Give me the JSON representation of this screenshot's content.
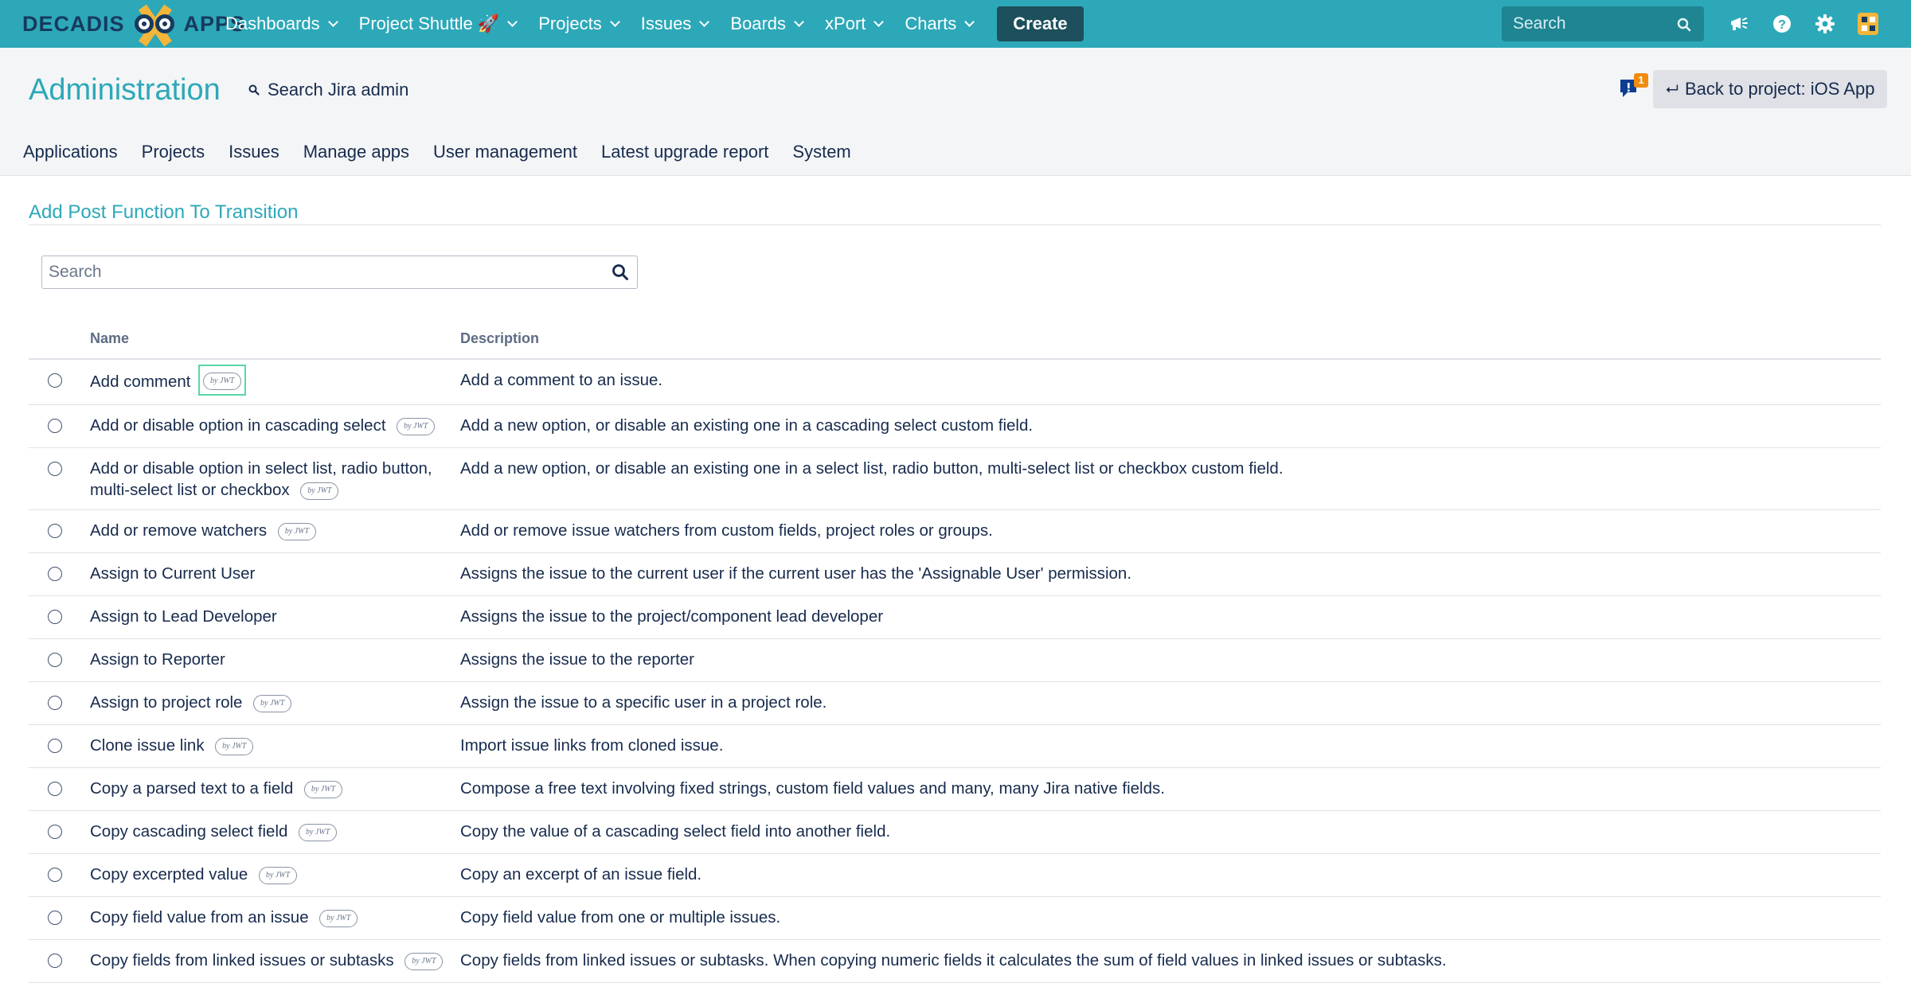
{
  "brand": {
    "name_left": "DECADIS",
    "name_right": "APPS",
    "accent": "#2da8b8",
    "dark": "#173a5e",
    "gold": "#f4b63a"
  },
  "topnav": {
    "items": [
      {
        "label": "Dashboards"
      },
      {
        "label": "Project Shuttle 🚀"
      },
      {
        "label": "Projects"
      },
      {
        "label": "Issues"
      },
      {
        "label": "Boards"
      },
      {
        "label": "xPort"
      },
      {
        "label": "Charts"
      }
    ],
    "create_label": "Create",
    "search_placeholder": "Search",
    "icons": [
      "announcement-icon",
      "help-icon",
      "settings-icon",
      "avatar"
    ]
  },
  "admin": {
    "title": "Administration",
    "search_label": "Search Jira admin",
    "notification_count": "1",
    "back_label": "Back to project: iOS App",
    "tabs": [
      {
        "label": "Applications"
      },
      {
        "label": "Projects"
      },
      {
        "label": "Issues"
      },
      {
        "label": "Manage apps"
      },
      {
        "label": "User management"
      },
      {
        "label": "Latest upgrade report"
      },
      {
        "label": "System"
      }
    ]
  },
  "content": {
    "heading": "Add Post Function To Transition",
    "search_placeholder": "Search",
    "columns": {
      "name": "Name",
      "description": "Description"
    },
    "badge_text": "by JWT",
    "rows": [
      {
        "name": "Add comment",
        "jwt": true,
        "description": "Add a comment to an issue."
      },
      {
        "name": "Add or disable option in cascading select",
        "jwt": true,
        "description": "Add a new option, or disable an existing one in a cascading select custom field."
      },
      {
        "name": "Add or disable option in select list, radio button, multi-select list or checkbox",
        "jwt": true,
        "description": "Add a new option, or disable an existing one in a select list, radio button, multi-select list or checkbox custom field."
      },
      {
        "name": "Add or remove watchers",
        "jwt": true,
        "description": "Add or remove issue watchers from custom fields, project roles or groups."
      },
      {
        "name": "Assign to Current User",
        "jwt": false,
        "description": "Assigns the issue to the current user if the current user has the 'Assignable User' permission."
      },
      {
        "name": "Assign to Lead Developer",
        "jwt": false,
        "description": "Assigns the issue to the project/component lead developer"
      },
      {
        "name": "Assign to Reporter",
        "jwt": false,
        "description": "Assigns the issue to the reporter"
      },
      {
        "name": "Assign to project role",
        "jwt": true,
        "description": "Assign the issue to a specific user in a project role."
      },
      {
        "name": "Clone issue link",
        "jwt": true,
        "description": "Import issue links from cloned issue."
      },
      {
        "name": "Copy a parsed text to a field",
        "jwt": true,
        "description": "Compose a free text involving fixed strings, custom field values and many, many Jira native fields."
      },
      {
        "name": "Copy cascading select field",
        "jwt": true,
        "description": "Copy the value of a cascading select field into another field."
      },
      {
        "name": "Copy excerpted value",
        "jwt": true,
        "description": "Copy an excerpt of an issue field."
      },
      {
        "name": "Copy field value from an issue",
        "jwt": true,
        "description": "Copy field value from one or multiple issues."
      },
      {
        "name": "Copy fields from linked issues or subtasks",
        "jwt": true,
        "description": "Copy fields from linked issues or subtasks. When copying numeric fields it calculates the sum of field values in linked issues or subtasks."
      }
    ]
  }
}
